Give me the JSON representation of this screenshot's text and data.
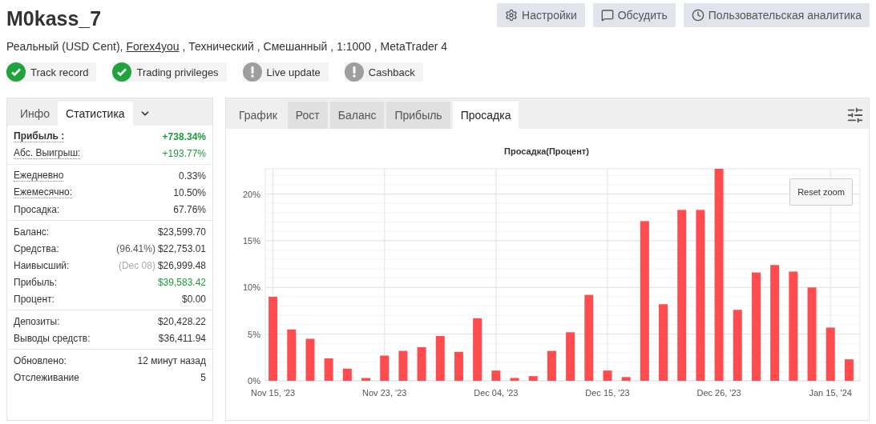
{
  "header": {
    "title": "M0kass_7",
    "buttons": [
      "Настройки",
      "Обсудить",
      "Пользовательская аналитика"
    ]
  },
  "account_line": {
    "before": "Реальный (USD Cent), ",
    "link": "Forex4you",
    "after": " , Технический , Смешанный , 1:1000 , MetaTrader 4"
  },
  "badges": [
    {
      "label": "Track record",
      "kind": "ok"
    },
    {
      "label": "Trading privileges",
      "kind": "ok"
    },
    {
      "label": "Live update",
      "kind": "warn"
    },
    {
      "label": "Cashback",
      "kind": "warn"
    }
  ],
  "stats_panel": {
    "tabs": [
      {
        "label": "Инфо",
        "selected": false
      },
      {
        "label": "Статистика",
        "selected": true
      }
    ],
    "groups": [
      [
        {
          "label": "Прибыль :",
          "value": "+738.34%",
          "positive": true,
          "bold": true,
          "underlined": true
        },
        {
          "label": "Абс. Выигрыш:",
          "value": "+193.77%",
          "positive": true,
          "bold": false,
          "underlined": true
        }
      ],
      [
        {
          "label": "Ежедневно",
          "value": "0.33%",
          "positive": false,
          "bold": false,
          "underlined": true
        },
        {
          "label": "Ежемесячно:",
          "value": "10.50%",
          "positive": false,
          "bold": false,
          "underlined": true
        },
        {
          "label": "Просадка:",
          "value": "67.76%",
          "positive": false,
          "bold": false,
          "underlined": false
        }
      ],
      [
        {
          "label": "Баланс:",
          "value": "$23,599.70",
          "positive": false,
          "bold": false,
          "underlined": false
        },
        {
          "label": "Средства:",
          "note": "(96.41%)",
          "note_muted": false,
          "value": "$22,753.01",
          "positive": false,
          "bold": false,
          "underlined": false
        },
        {
          "label": "Наивысший:",
          "note": "(Dec 08)",
          "note_muted": true,
          "value": "$26,999.48",
          "positive": false,
          "bold": false,
          "underlined": false
        },
        {
          "label": "Прибыль:",
          "value": "$39,583.42",
          "positive": true,
          "bold": false,
          "underlined": false
        },
        {
          "label": "Процент:",
          "value": "$0.00",
          "positive": false,
          "bold": false,
          "underlined": false
        }
      ],
      [
        {
          "label": "Депозиты:",
          "value": "$20,428.22",
          "positive": false,
          "bold": false,
          "underlined": false
        },
        {
          "label": "Выводы средств:",
          "value": "$36,411.94",
          "positive": false,
          "bold": false,
          "underlined": false
        }
      ],
      [
        {
          "label": "Обновлено:",
          "value": "12 минут назад",
          "positive": false,
          "bold": false,
          "underlined": false
        },
        {
          "label": "Отслеживание",
          "value": "5",
          "positive": false,
          "bold": false,
          "underlined": false
        }
      ]
    ]
  },
  "chart_panel": {
    "tabs": [
      {
        "label": "График",
        "kind": "heading",
        "selected": false
      },
      {
        "label": "Рост",
        "kind": "tab",
        "selected": false
      },
      {
        "label": "Баланс",
        "kind": "tab",
        "selected": false
      },
      {
        "label": "Прибыль",
        "kind": "tab",
        "selected": false
      },
      {
        "label": "Просадка",
        "kind": "tab",
        "selected": true
      }
    ],
    "reset_button": "Reset zoom",
    "chart_data": {
      "type": "bar",
      "title": "Просадка(Процент)",
      "categories": [
        "Nov 15, '23",
        null,
        null,
        null,
        null,
        null,
        "Nov 23, '23",
        null,
        null,
        null,
        null,
        null,
        "Dec 04, '23",
        null,
        null,
        null,
        null,
        null,
        "Dec 15, '23",
        null,
        null,
        null,
        null,
        null,
        "Dec 26, '23",
        null,
        null,
        null,
        null,
        null,
        "Jan 15, '24",
        null
      ],
      "series": [
        {
          "color": "#ff4d4f",
          "values": [
            9.0,
            5.5,
            4.5,
            2.4,
            1.3,
            0.3,
            2.7,
            3.2,
            3.6,
            4.8,
            3.1,
            6.7,
            1.1,
            0.3,
            0.5,
            3.2,
            5.2,
            9.2,
            1.1,
            0.4,
            17.1,
            8.2,
            18.3,
            18.3,
            22.7,
            7.6,
            11.6,
            12.4,
            11.7,
            10.0,
            5.7,
            2.3
          ]
        }
      ],
      "ylim": [
        0,
        22.7
      ],
      "grid": true,
      "yticks": [
        {
          "value": 0,
          "label": "0%"
        },
        {
          "value": 5,
          "label": "5%"
        },
        {
          "value": 10,
          "label": "10%"
        },
        {
          "value": 15,
          "label": "15%"
        },
        {
          "value": 20,
          "label": "20%"
        }
      ]
    }
  }
}
